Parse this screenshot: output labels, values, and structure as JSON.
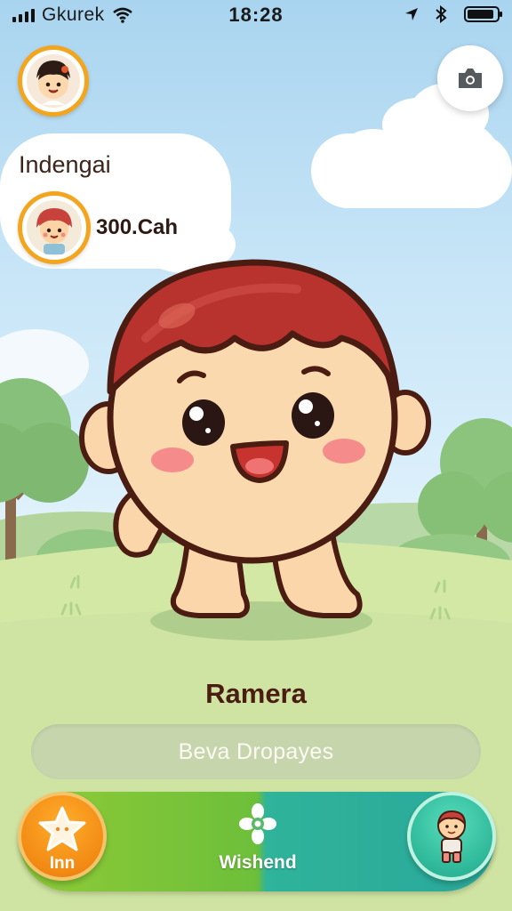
{
  "status_bar": {
    "carrier": "Gkurek",
    "time": "18:28",
    "icons": [
      "signal-bars-icon",
      "wifi-icon",
      "location-arrow-icon",
      "bluetooth-icon",
      "battery-icon"
    ]
  },
  "header": {
    "profile_avatar_icon": "child-avatar-icon",
    "camera_icon": "camera-icon"
  },
  "profile": {
    "title": "Indengai",
    "coins": "300.Cah"
  },
  "character": {
    "name": "Ramera"
  },
  "input": {
    "value": "Beva Dropayes"
  },
  "tab_bar": {
    "left": {
      "label": "Inn",
      "icon": "star-icon"
    },
    "middle": {
      "label": "Wishend",
      "icon": "flower-icon"
    },
    "right": {
      "icon": "kid-avatar-icon"
    }
  },
  "colors": {
    "sky": "#a9d4ef",
    "grass": "#cde4a0",
    "accent_orange": "#f28a14",
    "accent_green": "#8fcb37",
    "accent_teal": "#2bb596",
    "name_text": "#4a1c12"
  }
}
